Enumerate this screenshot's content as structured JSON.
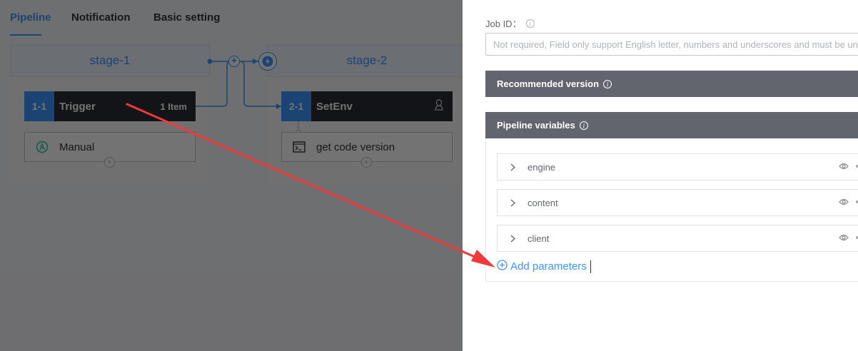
{
  "tabs": [
    {
      "label": "Pipeline",
      "active": true
    },
    {
      "label": "Notification",
      "active": false
    },
    {
      "label": "Basic setting",
      "active": false
    }
  ],
  "stages": [
    {
      "name": "stage-1",
      "job": {
        "number": "1-1",
        "name": "Trigger",
        "count": "1 Item"
      },
      "atom": {
        "label": "Manual",
        "icon": "manual-trigger-icon"
      }
    },
    {
      "name": "stage-2",
      "job": {
        "number": "2-1",
        "name": "SetEnv",
        "os_icon": "linux-icon"
      },
      "atom": {
        "label": "get code version",
        "icon": "terminal-icon"
      }
    }
  ],
  "panel": {
    "job_id_label": "Job ID：",
    "job_id_placeholder": "Not required, Field only support English letter, numbers and underscores and must be unique",
    "recommended_version_title": "Recommended version",
    "pipeline_variables_title": "Pipeline variables",
    "variables": [
      {
        "name": "engine"
      },
      {
        "name": "content"
      },
      {
        "name": "client"
      }
    ],
    "add_parameters_label": "Add parameters"
  },
  "colors": {
    "accent": "#3c96ff",
    "job_header": "#2b2d35",
    "section_bar": "#63656e",
    "annotation_arrow": "#f0393b"
  }
}
